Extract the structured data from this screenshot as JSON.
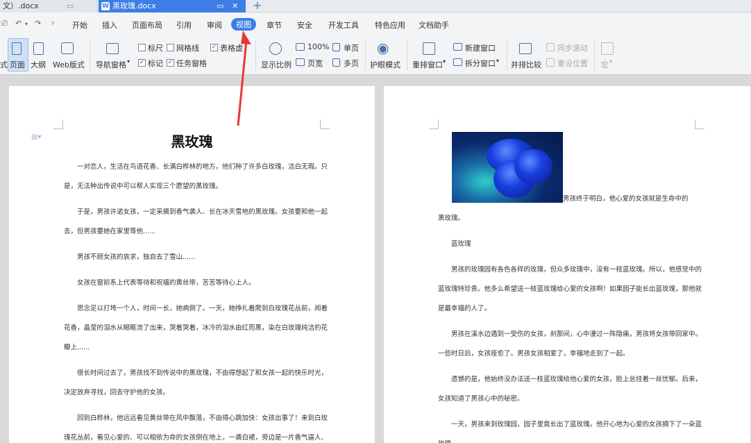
{
  "tabs": [
    {
      "label": "文）.docx"
    },
    {
      "label": "黑玫瑰.docx",
      "badge": "W"
    }
  ],
  "menu": [
    "开始",
    "插入",
    "页面布局",
    "引用",
    "审阅",
    "视图",
    "章节",
    "安全",
    "开发工具",
    "特色应用",
    "文档助手"
  ],
  "menu_selected": "视图",
  "ribbon": {
    "left_cut_label": "式",
    "page_label": "页面",
    "outline_label": "大纲",
    "web_label": "Web版式",
    "nav_pane_label": "导航窗格",
    "ruler_label": "标尺",
    "gridline_label": "网格线",
    "table_grid_label": "表格虚",
    "mark_label": "标记",
    "task_pane_label": "任务窗格",
    "zoom_label": "显示比例",
    "hundred_label": "100%",
    "page_width_label": "页宽",
    "single_page_label": "单页",
    "multi_page_label": "多页",
    "eye_mode_label": "护眼模式",
    "arrange_label": "重排窗口",
    "new_window_label": "新建窗口",
    "split_window_label": "拆分窗口",
    "side_by_side_label": "并排比较",
    "sync_scroll_label": "同步滚动",
    "reset_pos_label": "重设位置",
    "macro_label": "宏"
  },
  "checkboxes": {
    "ruler": false,
    "gridline": false,
    "table_grid": true,
    "mark": true,
    "task_pane": true
  },
  "document": {
    "title": "黑玫瑰",
    "left_lines": [
      "一对恋人，生活在鸟语花香、长满白桦林的地方，他们种了许多白玫瑰，洁白无瑕。只",
      "是，无法种出传说中可以帮人实现三个愿望的黑玫瑰。",
      "于是，男孩许诺女孩，一定采摘到香气袭人、长在冰天雪地的黑玫瑰。女孩要和他一起",
      "去，但男孩要她在家里等他......",
      "男孩不顾女孩的哀求，独自去了雪山......",
      "女孩在窗前系上代表等待和祝福的黄丝带，苦苦等待心上人。",
      "思念足以打垮一个人，时间一长，她病倒了。一天，她挣扎着爬到白玫瑰花丛前，闻着",
      "花香，晶莹的泪水从眼眶流了出来，哭着哭着，冰冷的泪水由红而黑，染在白玫瑰纯洁的花",
      "瓣上......",
      "很长时间过去了，男孩找不到传说中的黑玫瑰，不由得想起了和女孩一起的快乐时光，",
      "决定放弃寻找，回去守护他的女孩。",
      "回到白桦林，他远远看见黄丝带在风中飘落，不由得心跳加快：女孩出事了！来到白玫",
      "瑰花丛前，看见心爱的、可以相依为命的女孩倒在地上，一袭白裙，旁边是一片香气逼人、"
    ],
    "right_lines": [
      "男孩终于明白，他心爱的女孩就是生命中的",
      "黑玫瑰。",
      "蓝玫瑰",
      "男孩的玫瑰园有各色各样的玫瑰，但众多玫瑰中，没有一枝蓝玫瑰。所以，他感觉中的",
      "蓝玫瑰特珍贵。他多么希望送一枝蓝玫瑰给心爱的女孩啊！如果园子能长出蓝玫瑰，那他就",
      "是最幸福的人了。",
      "男孩在溪水边遇到一受伤的女孩，刹那间，心中漫过一阵隐痛，男孩将女孩带回家中。",
      "一些时日后，女孩痊愈了。男孩女孩相爱了，幸福地走到了一起。",
      "遗憾的是，他始终没办法送一枝蓝玫瑰给他心爱的女孩，脸上总挂着一丝忧郁。后来，",
      "女孩知道了男孩心中的秘密。",
      "一天，男孩来到玫瑰园，园子里竟长出了蓝玫瑰。他开心地为心爱的女孩摘下了一朵蓝",
      "玫瑰。"
    ]
  },
  "colors": {
    "accent": "#3d7ee6",
    "arrow": "#e53935"
  }
}
